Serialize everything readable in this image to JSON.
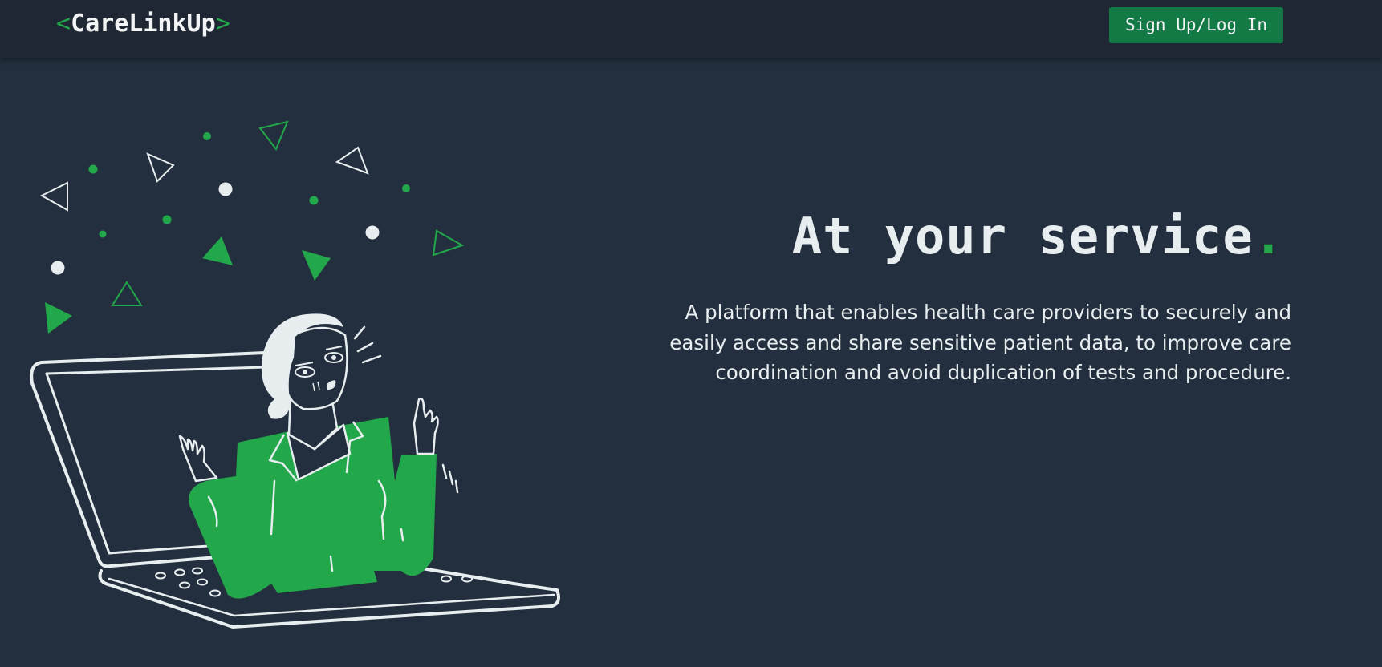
{
  "navbar": {
    "logo": {
      "open_bracket": "<",
      "name": "CareLinkUp",
      "close_bracket": ">"
    },
    "signup_label": "Sign Up/Log In"
  },
  "hero": {
    "title": "At your service",
    "title_dot": ".",
    "description": "A platform that enables health care providers to securely and easily access and share sensitive patient data, to improve care coordination and avoid duplication of tests and procedure."
  },
  "colors": {
    "background": "#232f3e",
    "navbar": "#1e2733",
    "accent": "#22a84a",
    "button": "#137a46",
    "text": "#e8eef0"
  },
  "illustration": {
    "subject": "woman-emerging-from-laptop",
    "icons": [
      "laptop-icon",
      "woman-icon",
      "confetti-triangles",
      "confetti-dots"
    ]
  }
}
